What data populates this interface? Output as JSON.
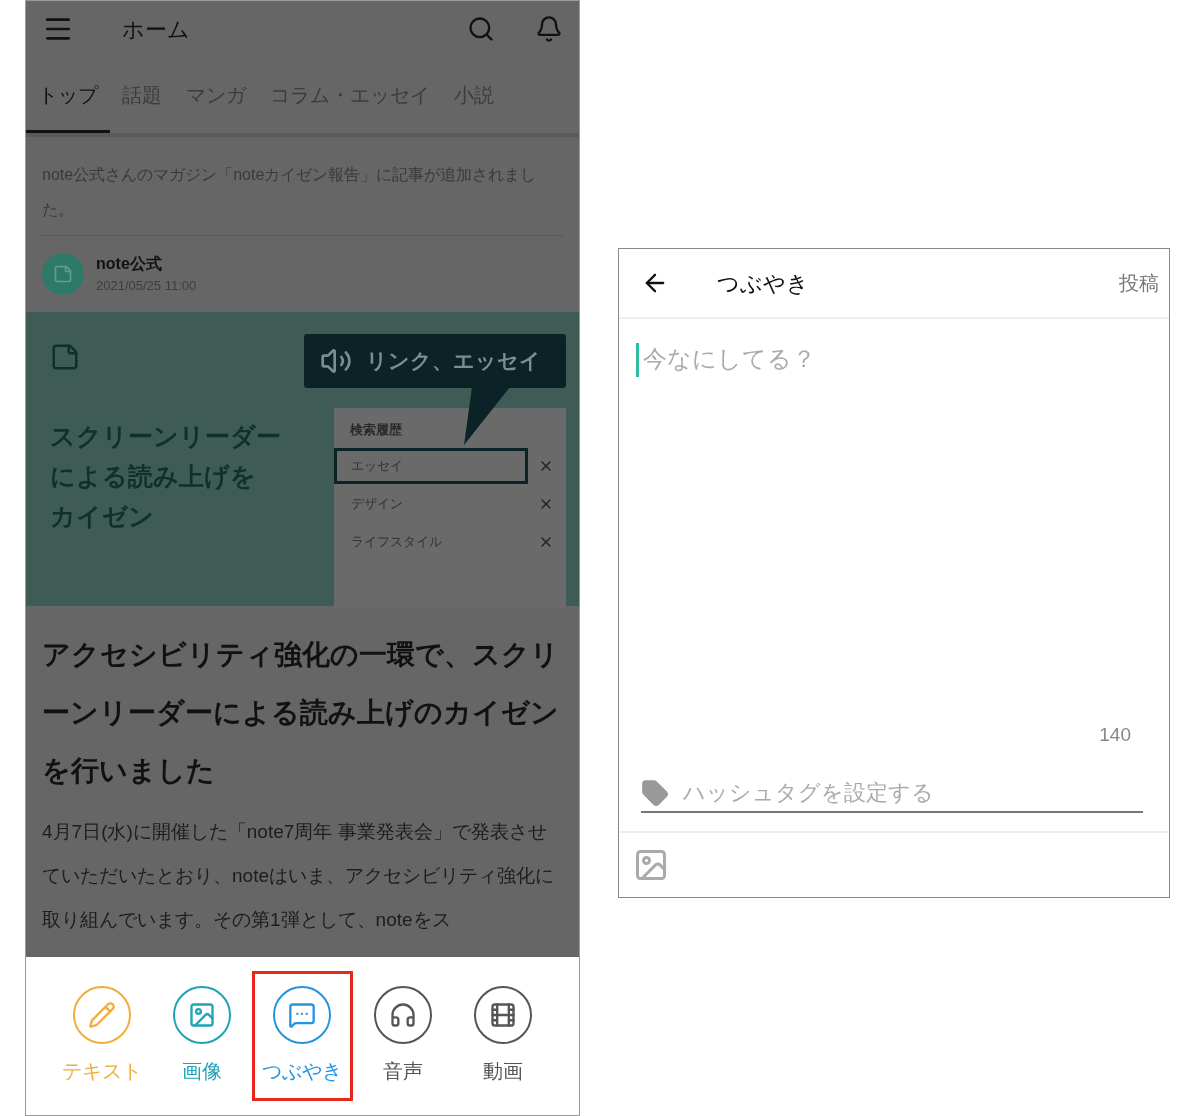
{
  "app_bar": {
    "title": "ホーム"
  },
  "tabs": [
    {
      "label": "トップ",
      "selected": true
    },
    {
      "label": "話題",
      "selected": false
    },
    {
      "label": "マンガ",
      "selected": false
    },
    {
      "label": "コラム・エッセイ",
      "selected": false
    },
    {
      "label": "小説",
      "selected": false
    }
  ],
  "notification": {
    "text": "note公式さんのマガジン「noteカイゼン報告」に記事が追加されました。",
    "author": "note公式",
    "date": "2021/05/25 11:00"
  },
  "banner": {
    "headline": [
      "スクリーンリーダー",
      "による読み上げを",
      "カイゼン"
    ],
    "speech_bubble": "リンク、エッセイ",
    "history_title": "検索履歴",
    "history": [
      {
        "label": "エッセイ",
        "focused": true
      },
      {
        "label": "デザイン",
        "focused": false
      },
      {
        "label": "ライフスタイル",
        "focused": false
      }
    ]
  },
  "article": {
    "title": "アクセシビリティ強化の一環で、スクリーンリーダーによる読み上げのカイゼンを行いました",
    "body": "4月7日(水)に開催した「note7周年 事業発表会」で発表させていただいたとおり、noteはいま、アクセシビリティ強化に取り組んでいます。その第1弾として、noteをス"
  },
  "post_menu": [
    {
      "label": "テキスト",
      "kind": "text",
      "color": "#f0ae3c",
      "selected": false
    },
    {
      "label": "画像",
      "kind": "image",
      "color": "#1fa3b5",
      "selected": false
    },
    {
      "label": "つぶやき",
      "kind": "murmur",
      "color": "#2594e0",
      "selected": true
    },
    {
      "label": "音声",
      "kind": "audio",
      "color": "#555555",
      "selected": false
    },
    {
      "label": "動画",
      "kind": "video",
      "color": "#555555",
      "selected": false
    }
  ],
  "compose": {
    "title": "つぶやき",
    "post": "投稿",
    "placeholder": "今なにしてる？",
    "counter": "140",
    "hashtag_placeholder": "ハッシュタグを設定する"
  }
}
